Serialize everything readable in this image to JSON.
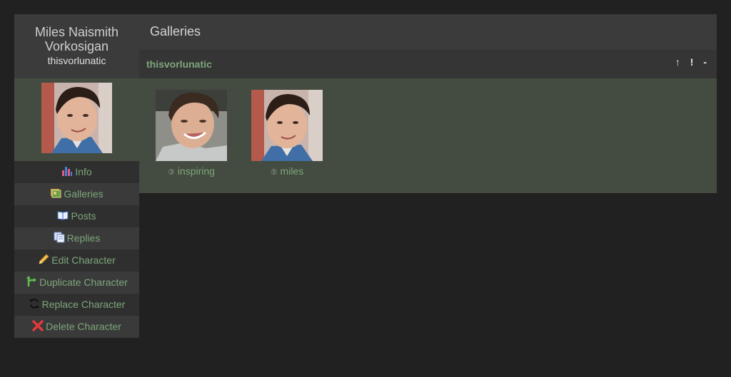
{
  "character": {
    "name": "Miles Naismith Vorkosigan",
    "name_line1": "Miles Naismith",
    "name_line2": "Vorkosigan",
    "screenname": "thisvorlunatic"
  },
  "menu": [
    {
      "label": "Info",
      "icon": "info-chart-icon"
    },
    {
      "label": "Galleries",
      "icon": "gallery-icon"
    },
    {
      "label": "Posts",
      "icon": "book-icon"
    },
    {
      "label": "Replies",
      "icon": "replies-pages-icon"
    },
    {
      "label": "Edit Character",
      "icon": "pencil-icon"
    },
    {
      "label": "Duplicate Character",
      "icon": "branch-icon"
    },
    {
      "label": "Replace Character",
      "icon": "refresh-icon"
    },
    {
      "label": "Delete Character",
      "icon": "red-x-icon"
    }
  ],
  "main": {
    "title": "Galleries"
  },
  "gallery": {
    "name": "thisvorlunatic",
    "actions": [
      "↑",
      "!",
      "-"
    ],
    "icons": [
      {
        "prefix": "③",
        "keyword": "inspiring"
      },
      {
        "prefix": "⑤",
        "keyword": "miles"
      }
    ]
  },
  "colors": {
    "background": "#212121",
    "header": "#3b3b3b",
    "panel_green": "#444b40",
    "link_green": "#7da77b"
  }
}
